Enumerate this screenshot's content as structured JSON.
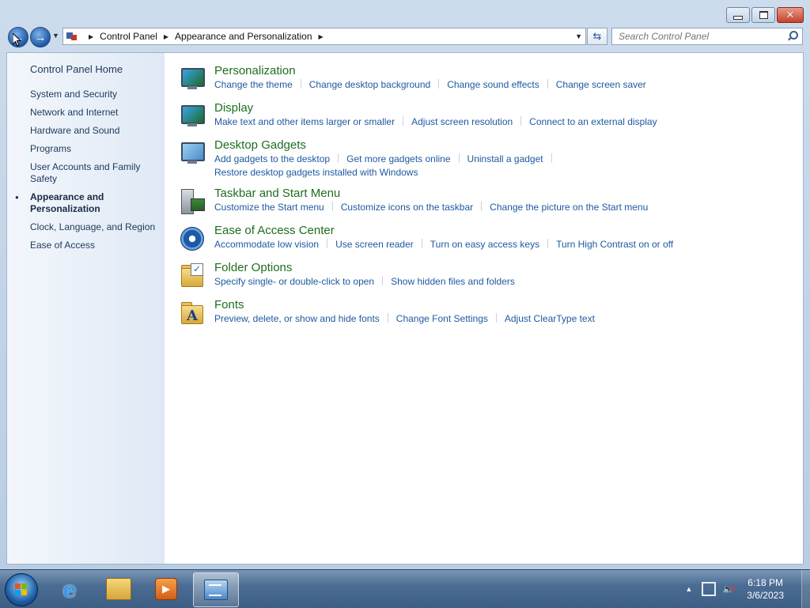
{
  "address": {
    "crumbs": [
      "Control Panel",
      "Appearance and Personalization"
    ],
    "search_placeholder": "Search Control Panel"
  },
  "sidebar": {
    "home": "Control Panel Home",
    "items": [
      {
        "label": "System and Security",
        "active": false
      },
      {
        "label": "Network and Internet",
        "active": false
      },
      {
        "label": "Hardware and Sound",
        "active": false
      },
      {
        "label": "Programs",
        "active": false
      },
      {
        "label": "User Accounts and Family Safety",
        "active": false
      },
      {
        "label": "Appearance and Personalization",
        "active": true
      },
      {
        "label": "Clock, Language, and Region",
        "active": false
      },
      {
        "label": "Ease of Access",
        "active": false
      }
    ]
  },
  "categories": [
    {
      "title": "Personalization",
      "icon": "personalization-icon",
      "links": [
        "Change the theme",
        "Change desktop background",
        "Change sound effects",
        "Change screen saver"
      ]
    },
    {
      "title": "Display",
      "icon": "display-icon",
      "links": [
        "Make text and other items larger or smaller",
        "Adjust screen resolution",
        "Connect to an external display"
      ]
    },
    {
      "title": "Desktop Gadgets",
      "icon": "gadgets-icon",
      "links": [
        "Add gadgets to the desktop",
        "Get more gadgets online",
        "Uninstall a gadget",
        "Restore desktop gadgets installed with Windows"
      ]
    },
    {
      "title": "Taskbar and Start Menu",
      "icon": "taskbar-icon",
      "links": [
        "Customize the Start menu",
        "Customize icons on the taskbar",
        "Change the picture on the Start menu"
      ]
    },
    {
      "title": "Ease of Access Center",
      "icon": "ease-of-access-icon",
      "links": [
        "Accommodate low vision",
        "Use screen reader",
        "Turn on easy access keys",
        "Turn High Contrast on or off"
      ]
    },
    {
      "title": "Folder Options",
      "icon": "folder-options-icon",
      "links": [
        "Specify single- or double-click to open",
        "Show hidden files and folders"
      ]
    },
    {
      "title": "Fonts",
      "icon": "fonts-icon",
      "links": [
        "Preview, delete, or show and hide fonts",
        "Change Font Settings",
        "Adjust ClearType text"
      ]
    }
  ],
  "taskbar": {
    "time": "6:18 PM",
    "date": "3/6/2023"
  },
  "colors": {
    "link": "#1e5aa0",
    "category_title": "#1e6e1e"
  }
}
